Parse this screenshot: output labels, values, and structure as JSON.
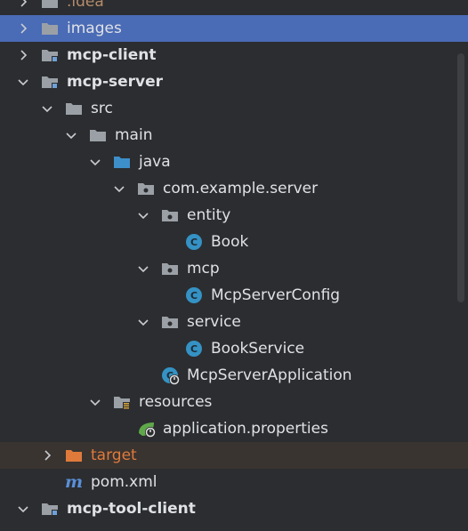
{
  "tree": {
    "items": [
      {
        "label": ".idea",
        "depth": 0,
        "icon": "folder-icon",
        "arrow": "right"
      },
      {
        "label": "images",
        "depth": 0,
        "icon": "folder-icon",
        "arrow": "right",
        "selected": true
      },
      {
        "label": "mcp-client",
        "depth": 0,
        "icon": "module-folder-icon",
        "arrow": "right",
        "bold": true
      },
      {
        "label": "mcp-server",
        "depth": 0,
        "icon": "module-folder-icon",
        "arrow": "down",
        "bold": true
      },
      {
        "label": "src",
        "depth": 1,
        "icon": "folder-icon",
        "arrow": "down"
      },
      {
        "label": "main",
        "depth": 2,
        "icon": "folder-icon",
        "arrow": "down"
      },
      {
        "label": "java",
        "depth": 3,
        "icon": "source-folder-icon",
        "arrow": "down"
      },
      {
        "label": "com.example.server",
        "depth": 4,
        "icon": "package-icon",
        "arrow": "down"
      },
      {
        "label": "entity",
        "depth": 5,
        "icon": "package-icon",
        "arrow": "down"
      },
      {
        "label": "Book",
        "depth": 6,
        "icon": "class-icon",
        "arrow": "none"
      },
      {
        "label": "mcp",
        "depth": 5,
        "icon": "package-icon",
        "arrow": "down"
      },
      {
        "label": "McpServerConfig",
        "depth": 6,
        "icon": "class-icon",
        "arrow": "none"
      },
      {
        "label": "service",
        "depth": 5,
        "icon": "package-icon",
        "arrow": "down"
      },
      {
        "label": "BookService",
        "depth": 6,
        "icon": "class-icon",
        "arrow": "none"
      },
      {
        "label": "McpServerApplication",
        "depth": 5,
        "icon": "spring-boot-app-icon",
        "arrow": "none"
      },
      {
        "label": "resources",
        "depth": 3,
        "icon": "resources-folder-icon",
        "arrow": "down"
      },
      {
        "label": "application.properties",
        "depth": 4,
        "icon": "spring-properties-icon",
        "arrow": "none"
      },
      {
        "label": "target",
        "depth": 1,
        "icon": "excluded-folder-icon",
        "arrow": "right",
        "excluded": true
      },
      {
        "label": "pom.xml",
        "depth": 1,
        "icon": "maven-icon",
        "arrow": "none"
      },
      {
        "label": "mcp-tool-client",
        "depth": 0,
        "icon": "module-folder-icon",
        "arrow": "down",
        "bold": true
      }
    ]
  },
  "colors": {
    "background": "#2b2d30",
    "selection": "#4a6bb5",
    "folder": "#9aa0a6",
    "source_folder": "#3d8fc9",
    "class": "#3592c4",
    "excluded": "#e07a3b",
    "spring": "#5fa84a"
  }
}
